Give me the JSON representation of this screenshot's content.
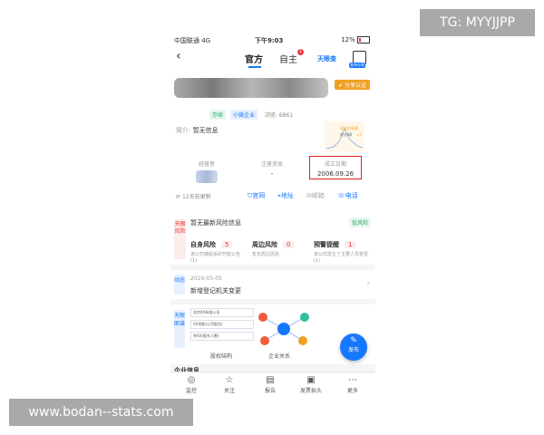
{
  "watermarks": {
    "top": "TG: MYYJJPP",
    "bottom": "www.bodan--stats.com"
  },
  "statusbar": {
    "carrier": "中国联通 4G",
    "time": "下午9:03",
    "battery": "12%"
  },
  "nav": {
    "tab_official": "官方",
    "tab_self": "自主",
    "badge": "1",
    "brand": "天眼查",
    "share_badge": "发布分享"
  },
  "company": {
    "cert_label": "✔ 分享认证",
    "tags": [
      "存续",
      "小微企业",
      "浏览: 6861"
    ],
    "intro_key": "简介:",
    "intro_value": "暂无信息",
    "mini_chart": {
      "label": "深圳后新城",
      "value": "评分36",
      "delta": "↓2"
    },
    "info": [
      {
        "key": "经营者",
        "value": ""
      },
      {
        "key": "注册资本",
        "value": "-"
      },
      {
        "key": "成立日期",
        "value": "2006.09.26"
      }
    ],
    "updated": "12天前更新",
    "links": [
      "官网",
      "地址",
      "邮箱",
      "电话"
    ]
  },
  "risk": {
    "side": "天眼风险",
    "header": "暂无最新风险信息",
    "level": "低风险",
    "cols": [
      {
        "name": "自身风险",
        "count": "5",
        "desc": "该公司被起诉的开庭公告(1)"
      },
      {
        "name": "周边风险",
        "count": "0",
        "desc": "暂无周边风险"
      },
      {
        "name": "预警提醒",
        "count": "1",
        "desc": "该公司发生了主要人员变更(1)"
      }
    ]
  },
  "dynamic": {
    "side": "动态",
    "date": "2020-05-05",
    "text": "新增登记机关变更"
  },
  "graph": {
    "side": "天眼图谱",
    "equity_items": [
      "北京XX有限公司",
      "XX控股(公司股东)",
      "李XX(股东人数)"
    ],
    "equity_label": "股权结构",
    "relation_label": "企业关系"
  },
  "fab": {
    "label": "发布"
  },
  "peek": "企业信息",
  "bottomnav": [
    "监控",
    "关注",
    "报告",
    "发票抬头",
    "更多"
  ]
}
